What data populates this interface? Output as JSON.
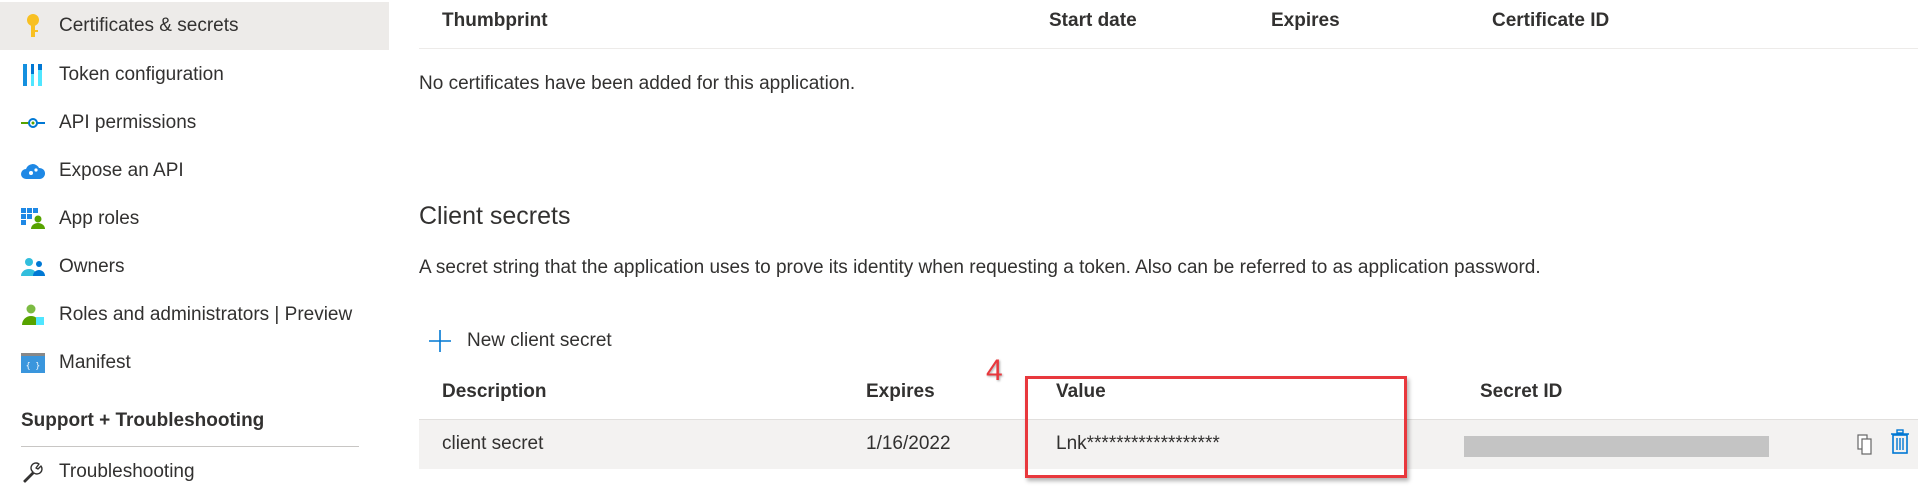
{
  "sidebar": {
    "items": [
      {
        "label": "Certificates & secrets",
        "icon": "key-icon",
        "active": true
      },
      {
        "label": "Token configuration",
        "icon": "token-bars-icon"
      },
      {
        "label": "API permissions",
        "icon": "api-permissions-icon"
      },
      {
        "label": "Expose an API",
        "icon": "cloud-gear-icon"
      },
      {
        "label": "App roles",
        "icon": "app-roles-icon"
      },
      {
        "label": "Owners",
        "icon": "owners-icon"
      },
      {
        "label": "Roles and administrators | Preview",
        "icon": "roles-admin-icon"
      },
      {
        "label": "Manifest",
        "icon": "manifest-icon"
      }
    ],
    "section_heading": "Support + Troubleshooting",
    "support_items": [
      {
        "label": "Troubleshooting",
        "icon": "wrench-icon"
      }
    ]
  },
  "certificates": {
    "columns": [
      "Thumbprint",
      "Start date",
      "Expires",
      "Certificate ID"
    ],
    "empty_message": "No certificates have been added for this application."
  },
  "client_secrets": {
    "title": "Client secrets",
    "description": "A secret string that the application uses to prove its identity when requesting a token. Also can be referred to as application password.",
    "new_button": "New client secret",
    "columns": [
      "Description",
      "Expires",
      "Value",
      "Secret ID"
    ],
    "rows": [
      {
        "description": "client secret",
        "expires": "1/16/2022",
        "value": "Lnk******************"
      }
    ]
  },
  "annotation": {
    "step": "4",
    "color": "#e8383d"
  },
  "colors": {
    "accent": "#0078d4",
    "selected_bg": "#edebe9",
    "row_bg": "#f3f2f1"
  }
}
